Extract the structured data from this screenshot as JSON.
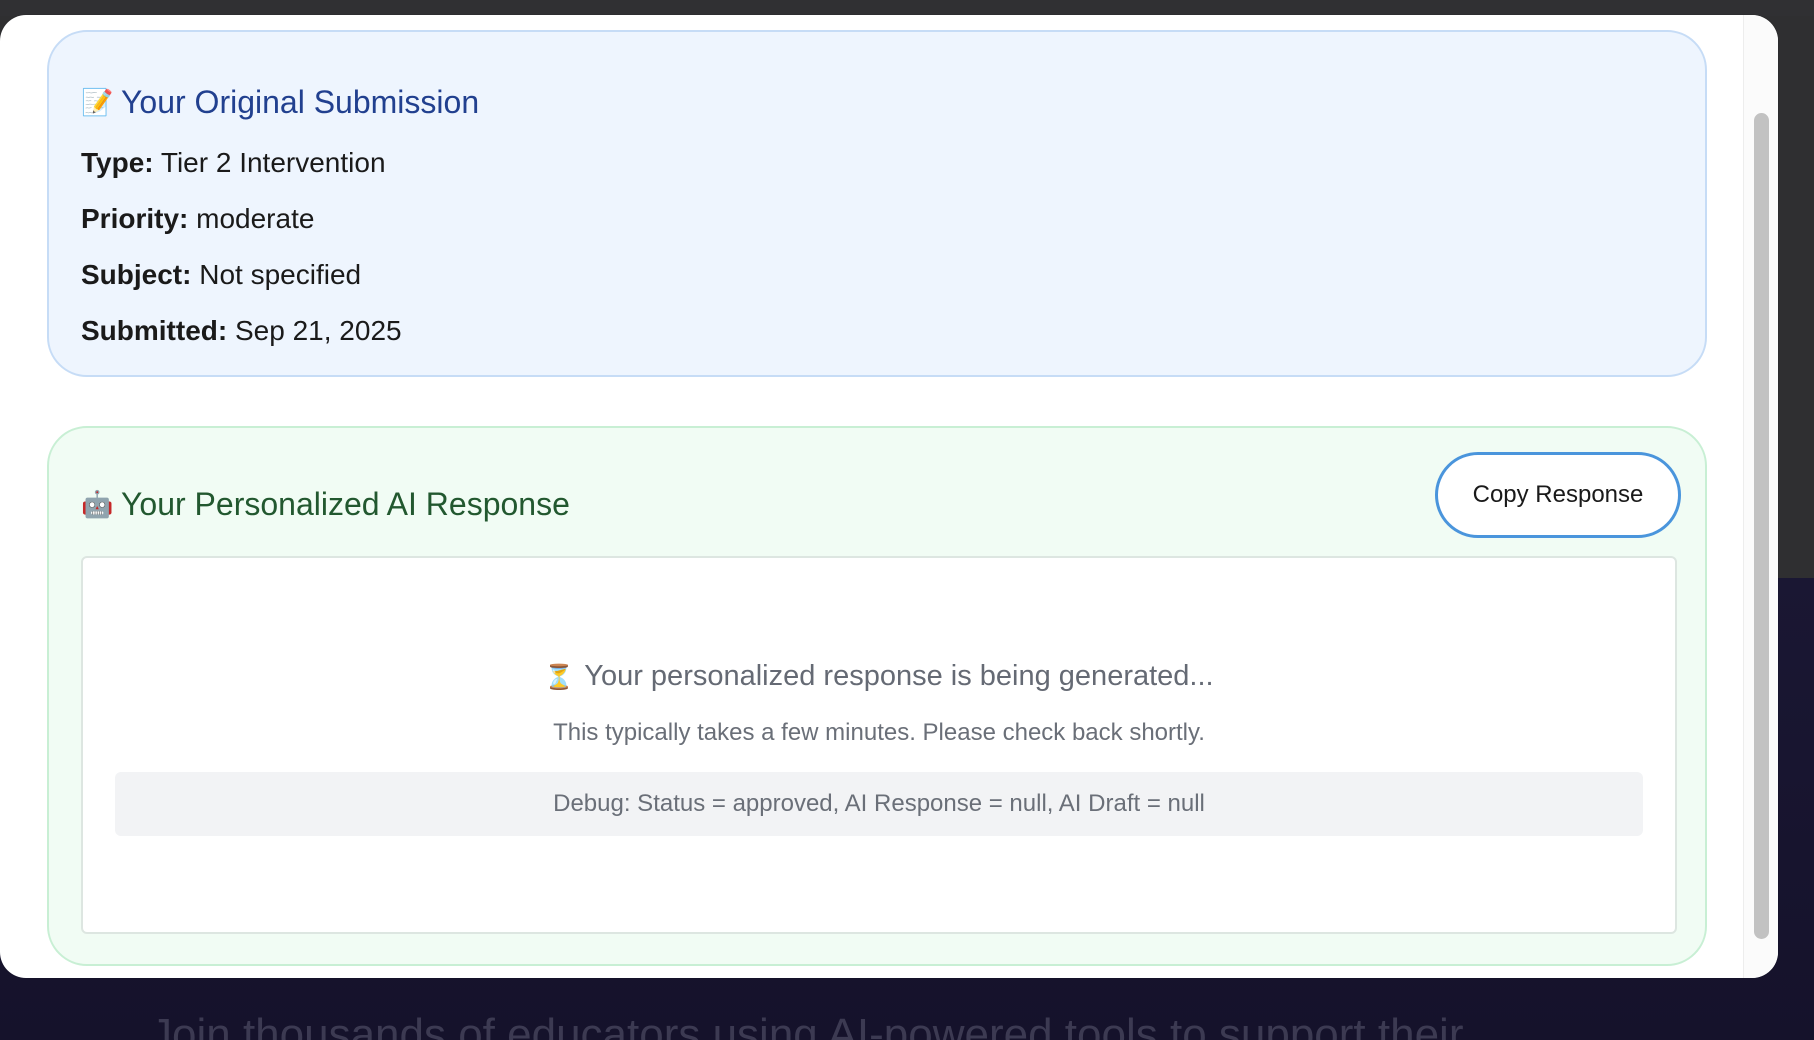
{
  "background": {
    "tagline": "Join thousands of educators using AI-powered tools to support their"
  },
  "submission": {
    "icon": "memo-icon",
    "title": "Your Original Submission",
    "fields": [
      {
        "label": "Type:",
        "value": "Tier 2 Intervention"
      },
      {
        "label": "Priority:",
        "value": "moderate"
      },
      {
        "label": "Subject:",
        "value": "Not specified"
      },
      {
        "label": "Submitted:",
        "value": "Sep 21, 2025"
      }
    ]
  },
  "response": {
    "icon": "robot-icon",
    "title": "Your Personalized AI Response",
    "copy_label": "Copy Response",
    "status_icon": "hourglass-icon",
    "status_text": "Your personalized response is being generated...",
    "status_sub": "This typically takes a few minutes. Please check back shortly.",
    "debug": "Debug: Status = approved, AI Response = null, AI Draft = null"
  },
  "colors": {
    "submission_bg": "#eef5fe",
    "submission_title": "#21408f",
    "response_bg": "#f1fcf4",
    "response_title": "#22582f",
    "button_border": "#4a95dc"
  }
}
